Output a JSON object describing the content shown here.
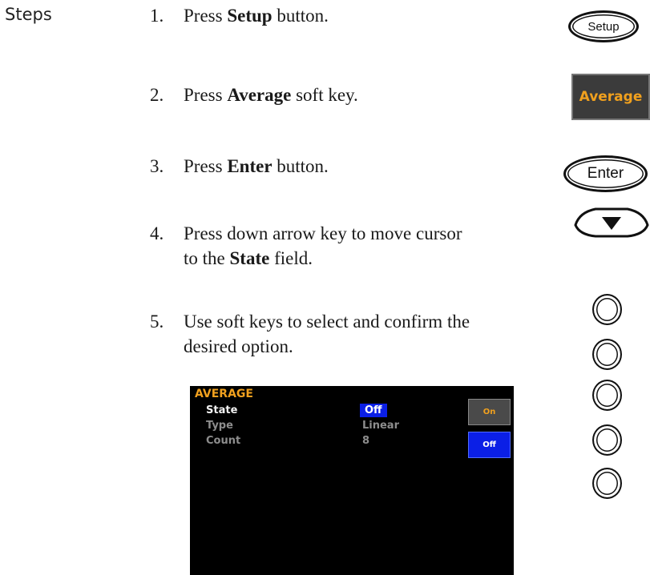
{
  "section_label": "Steps",
  "steps": [
    {
      "num": "1.",
      "pre": "Press ",
      "bold": "Setup",
      "post": " button."
    },
    {
      "num": "2.",
      "pre": "Press ",
      "bold": "Average",
      "post": " soft key."
    },
    {
      "num": "3.",
      "pre": "Press ",
      "bold": "Enter",
      "post": " button."
    },
    {
      "num": "4.",
      "pre": "Press down arrow key to move cursor",
      "cont_pre": "to the ",
      "bold": "State",
      "post": " field."
    },
    {
      "num": "5.",
      "pre": "Use soft keys to select and confirm the",
      "cont": "desired option."
    }
  ],
  "buttons": {
    "setup": "Setup",
    "average": "Average",
    "enter": "Enter",
    "down_arrow_icon": "down-arrow-icon",
    "soft_key_count": 5
  },
  "screen": {
    "title": "AVERAGE",
    "rows": [
      {
        "label": "State",
        "value": "Off",
        "selected": true
      },
      {
        "label": "Type",
        "value": "Linear",
        "selected": false
      },
      {
        "label": "Count",
        "value": "8",
        "selected": false
      }
    ],
    "softkeys": {
      "on": "On",
      "off": "Off"
    }
  },
  "colors": {
    "accent_orange": "#f0a01e",
    "highlight_blue": "#0b1fe6",
    "screen_bg": "#000000"
  }
}
